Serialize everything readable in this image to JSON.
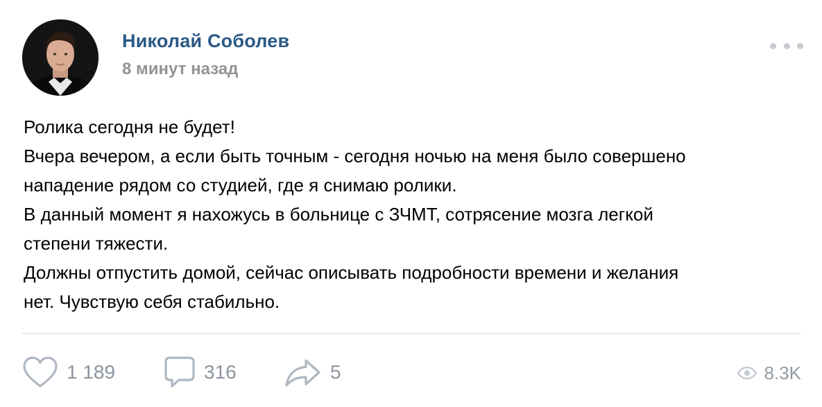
{
  "post": {
    "author": "Николай Соболев",
    "time": "8 минут назад",
    "lines": [
      "Ролика сегодня не будет!",
      "Вчера вечером, а если быть точным - сегодня ночью на меня было совершено",
      "нападение рядом со студией, где я снимаю ролики.",
      "В данный момент я нахожусь в больнице с ЗЧМТ, сотрясение мозга легкой",
      "степени тяжести.",
      "Должны отпустить домой, сейчас описывать подробности времени и желания",
      "нет. Чувствую себя стабильно."
    ]
  },
  "footer": {
    "likes": "1 189",
    "comments": "316",
    "shares": "5",
    "views": "8.3K"
  },
  "icons": {
    "like": "heart-icon",
    "comment": "comment-bubble-icon",
    "share": "share-arrow-icon",
    "views": "eye-icon",
    "more": "more-dots-icon"
  },
  "colors": {
    "author": "#2a5885",
    "muted": "#939393",
    "icon": "#aeb7c2",
    "divider": "#e7e8ec"
  }
}
